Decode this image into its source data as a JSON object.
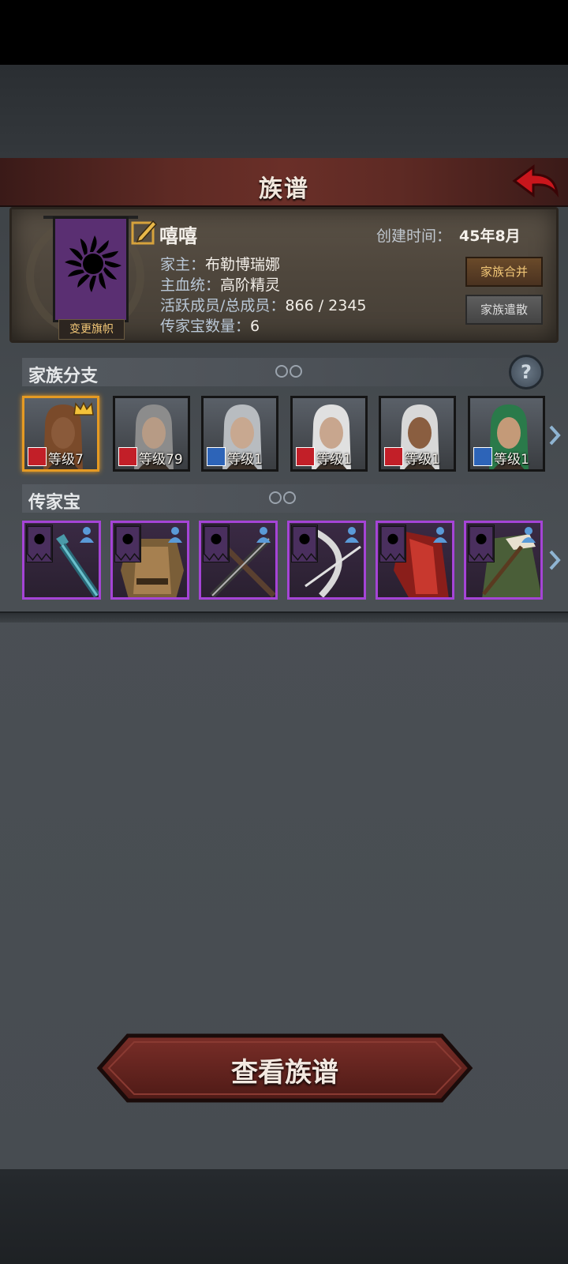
{
  "header": {
    "title": "族谱"
  },
  "family": {
    "name": "嘻嘻",
    "create_label": "创建时间：",
    "create_value": "45年8月",
    "change_flag_label": "变更旗帜",
    "info": [
      {
        "label": "家主：",
        "value": "布勒博瑞娜"
      },
      {
        "label": "主血统：",
        "value": "高阶精灵"
      },
      {
        "label": "活跃成员/总成员：",
        "value": "866 / 2345"
      },
      {
        "label": "传家宝数量：",
        "value": "6"
      }
    ],
    "merge_label": "家族合并",
    "disband_label": "家族遣散"
  },
  "branches": {
    "title": "家族分支",
    "members": [
      {
        "level": "等级7",
        "badge": "wolf-icon",
        "color": "#c21f28",
        "selected": true
      },
      {
        "level": "等级79",
        "badge": "wolf-icon",
        "color": "#c21f28"
      },
      {
        "level": "等级1",
        "badge": "sword-icon",
        "color": "#2d64b8"
      },
      {
        "level": "等级1",
        "badge": "wolf-icon",
        "color": "#c21f28"
      },
      {
        "level": "等级1",
        "badge": "wolf-icon",
        "color": "#c21f28"
      },
      {
        "level": "等级1",
        "badge": "sword-icon",
        "color": "#2d64b8"
      }
    ]
  },
  "heirlooms": {
    "title": "传家宝",
    "items": [
      {
        "name": "mace-icon"
      },
      {
        "name": "armor-icon"
      },
      {
        "name": "crossed-blades-icon"
      },
      {
        "name": "bow-icon"
      },
      {
        "name": "red-cloak-icon"
      },
      {
        "name": "green-coat-icon"
      }
    ],
    "rarity_color": "#a544d6"
  },
  "main_button": {
    "label": "查看族谱"
  }
}
